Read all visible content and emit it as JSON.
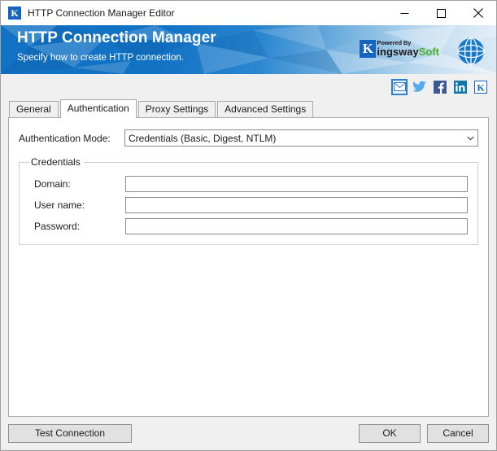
{
  "window": {
    "title": "HTTP Connection Manager Editor",
    "app_icon": "kingswaysoft-k-icon",
    "controls": {
      "minimize": "minimize-icon",
      "maximize": "maximize-icon",
      "close": "close-icon"
    }
  },
  "banner": {
    "title": "HTTP Connection Manager",
    "subtitle": "Specify how to create HTTP connection.",
    "logo": {
      "mark": "K",
      "powered_by": "Powered By",
      "name_first": "ingsway",
      "name_second": "Soft",
      "accent_color": "#4caf2a",
      "mark_color": "#1565c0"
    },
    "globe_icon": "globe-icon",
    "background_color": "#1272c4"
  },
  "social": [
    {
      "name": "email-icon",
      "label": "Email",
      "focused": true
    },
    {
      "name": "twitter-icon",
      "label": "Twitter",
      "focused": false
    },
    {
      "name": "facebook-icon",
      "label": "Facebook",
      "focused": false
    },
    {
      "name": "linkedin-icon",
      "label": "LinkedIn",
      "focused": false
    },
    {
      "name": "kingswaysoft-icon",
      "label": "KingswaySoft",
      "focused": false
    }
  ],
  "tabs": [
    {
      "label": "General",
      "active": false
    },
    {
      "label": "Authentication",
      "active": true
    },
    {
      "label": "Proxy Settings",
      "active": false
    },
    {
      "label": "Advanced Settings",
      "active": false
    }
  ],
  "form": {
    "auth_mode_label": "Authentication Mode:",
    "auth_mode_value": "Credentials (Basic, Digest, NTLM)",
    "auth_mode_arrow": "chevron-down-icon",
    "credentials_legend": "Credentials",
    "fields": [
      {
        "label": "Domain:",
        "value": "",
        "placeholder": ""
      },
      {
        "label": "User name:",
        "value": "",
        "placeholder": ""
      },
      {
        "label": "Password:",
        "value": "",
        "placeholder": ""
      }
    ]
  },
  "footer": {
    "test_connection": "Test Connection",
    "ok": "OK",
    "cancel": "Cancel"
  }
}
